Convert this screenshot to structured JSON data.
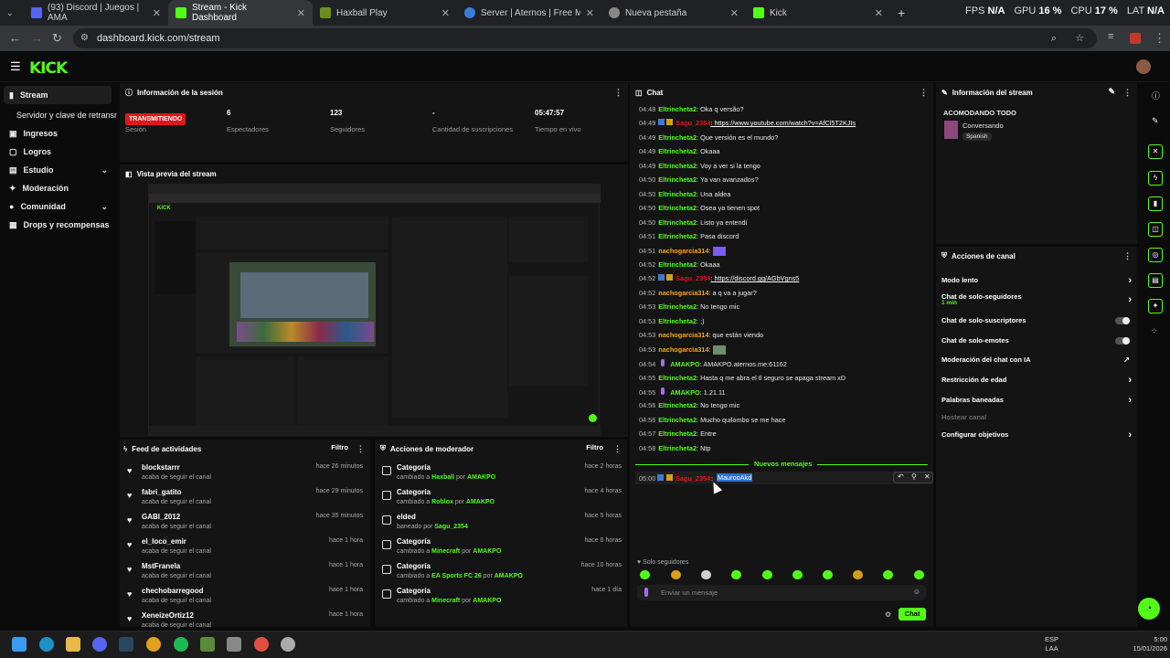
{
  "browser": {
    "tabs": [
      {
        "title": "(93) Discord | Juegos | AMA",
        "color": "#5865f2"
      },
      {
        "title": "Stream - Kick Dashboard",
        "color": "#53fc18"
      },
      {
        "title": "Haxball Play",
        "color": "#6b8e23"
      },
      {
        "title": "Server | Aternos | Free Minecraft",
        "color": "#3a7bd5"
      },
      {
        "title": "Nueva pestaña",
        "color": "#888888"
      },
      {
        "title": "Kick",
        "color": "#53fc18"
      }
    ],
    "new_tab": "+",
    "url": "dashboard.kick.com/stream",
    "stats": {
      "fps_label": "FPS",
      "fps": "N/A",
      "gpu_label": "GPU",
      "gpu": "16 %",
      "cpu_label": "CPU",
      "cpu": "17 %",
      "lat_label": "LAT",
      "lat": "N/A"
    }
  },
  "kick": {
    "logo": "KICK"
  },
  "sidebar": {
    "items": [
      {
        "label": "Stream"
      },
      {
        "label": "Servidor y clave de retransmisión"
      },
      {
        "label": "Ingresos"
      },
      {
        "label": "Logros"
      },
      {
        "label": "Estudio"
      },
      {
        "label": "Moderación"
      },
      {
        "label": "Comunidad"
      },
      {
        "label": "Drops y recompensas"
      }
    ]
  },
  "session": {
    "title": "Información de la sesión",
    "status": "TRANSMITIENDO",
    "status_label": "Sesión",
    "viewers": "6",
    "viewers_label": "Espectadores",
    "followers": "123",
    "followers_label": "Seguidores",
    "subs": "-",
    "subs_label": "Cantidad de suscripciones",
    "time": "05:47:57",
    "time_label": "Tiempo en vivo"
  },
  "preview": {
    "title": "Vista previa del stream"
  },
  "feed": {
    "title": "Feed de actividades",
    "filter": "Filtro",
    "items": [
      {
        "name": "blockstarrr",
        "sub": "acaba de seguir el canal",
        "time": "hace 26 minutos"
      },
      {
        "name": "fabri_gatito",
        "sub": "acaba de seguir el canal",
        "time": "hace 29 minutos"
      },
      {
        "name": "GABI_2012",
        "sub": "acaba de seguir el canal",
        "time": "hace 35 minutos"
      },
      {
        "name": "el_loco_emir",
        "sub": "acaba de seguir el canal",
        "time": "hace 1 hora"
      },
      {
        "name": "MstFranela",
        "sub": "acaba de seguir el canal",
        "time": "hace 1 hora"
      },
      {
        "name": "chechobarregood",
        "sub": "acaba de seguir el canal",
        "time": "hace 1 hora"
      },
      {
        "name": "XeneizeOrtiz12",
        "sub": "acaba de seguir el canal",
        "time": "hace 1 hora"
      }
    ]
  },
  "modactions": {
    "title": "Acciones de moderador",
    "filter": "Filtro",
    "items": [
      {
        "name": "Categoría",
        "pre": "cambiado a ",
        "target": "Haxball",
        "mid": " por ",
        "by": "AMAKPO",
        "time": "hace 2 horas"
      },
      {
        "name": "Categoría",
        "pre": "cambiado a ",
        "target": "Roblox",
        "mid": " por ",
        "by": "AMAKPO",
        "time": "hace 4 horas"
      },
      {
        "name": "elded",
        "pre": "baneado por ",
        "target": "Sagu_2354",
        "mid": "",
        "by": "",
        "time": "hace 5 horas"
      },
      {
        "name": "Categoría",
        "pre": "cambiado a ",
        "target": "Minecraft",
        "mid": " por ",
        "by": "AMAKPO",
        "time": "hace 6 horas"
      },
      {
        "name": "Categoría",
        "pre": "cambiado a ",
        "target": "EA Sports FC 26",
        "mid": " por ",
        "by": "AMAKPO",
        "time": "hace 10 horas"
      },
      {
        "name": "Categoría",
        "pre": "cambiado a ",
        "target": "Minecraft",
        "mid": " por ",
        "by": "AMAKPO",
        "time": "hace 1 día"
      }
    ]
  },
  "chat": {
    "title": "Chat",
    "messages": [
      {
        "t": "04:48",
        "u": "Eltrincheta2",
        "c": "#53fc18",
        "m": ": Oka q versão?"
      },
      {
        "t": "04:49",
        "u": "Sagu_2354",
        "c": "#e0161b",
        "m": ": https://www.youtube.com/watch?v=AfCl5T2KJIs",
        "link": true
      },
      {
        "t": "04:49",
        "u": "Eltrincheta2",
        "c": "#53fc18",
        "m": ": Que versión es el mundo?"
      },
      {
        "t": "04:49",
        "u": "Eltrincheta2",
        "c": "#53fc18",
        "m": ": Okaaa"
      },
      {
        "t": "04:49",
        "u": "Eltrincheta2",
        "c": "#53fc18",
        "m": ": Voy a ver si la tengo"
      },
      {
        "t": "04:50",
        "u": "Eltrincheta2",
        "c": "#53fc18",
        "m": ": Ya van avanzados?"
      },
      {
        "t": "04:50",
        "u": "Eltrincheta2",
        "c": "#53fc18",
        "m": ": Una aldea"
      },
      {
        "t": "04:50",
        "u": "Eltrincheta2",
        "c": "#53fc18",
        "m": ": Osea ya tienen spot"
      },
      {
        "t": "04:50",
        "u": "Eltrincheta2",
        "c": "#53fc18",
        "m": ": Listo ya entendí"
      },
      {
        "t": "04:51",
        "u": "Eltrincheta2",
        "c": "#53fc18",
        "m": ": Pasa discord"
      },
      {
        "t": "04:51",
        "u": "nachogarcia314",
        "c": "#f5a623",
        "m": ":"
      },
      {
        "t": "04:52",
        "u": "Eltrincheta2",
        "c": "#53fc18",
        "m": ": Okaaa"
      },
      {
        "t": "04:52",
        "u": "Sagu_2354",
        "c": "#e0161b",
        "m": ": https://discord.gg/AGbVgns5",
        "link": true
      },
      {
        "t": "04:52",
        "u": "nachogarcia314",
        "c": "#f5a623",
        "m": ": a q va a jugar?"
      },
      {
        "t": "04:53",
        "u": "Eltrincheta2",
        "c": "#53fc18",
        "m": ": No tengo mic"
      },
      {
        "t": "04:53",
        "u": "Eltrincheta2",
        "c": "#53fc18",
        "m": ": ;)"
      },
      {
        "t": "04:53",
        "u": "nachogarcia314",
        "c": "#f5a623",
        "m": ": que están viendo"
      },
      {
        "t": "04:53",
        "u": "nachogarcia314",
        "c": "#f5a623",
        "m": ":"
      },
      {
        "t": "04:54",
        "u": "AMAKPO",
        "c": "#53fc18",
        "m": ": AMAKPO.aternos.me:61162"
      },
      {
        "t": "04:55",
        "u": "Eltrincheta2",
        "c": "#53fc18",
        "m": ": Hasta q me abra el tl seguro se apaga stream xD"
      },
      {
        "t": "04:55",
        "u": "AMAKPO",
        "c": "#53fc18",
        "m": ": 1.21.11"
      },
      {
        "t": "04:56",
        "u": "Eltrincheta2",
        "c": "#53fc18",
        "m": ": No tengo mic"
      },
      {
        "t": "04:56",
        "u": "Eltrincheta2",
        "c": "#53fc18",
        "m": ": Mucho quilombo se me hace"
      },
      {
        "t": "04:57",
        "u": "Eltrincheta2",
        "c": "#53fc18",
        "m": ": Entre"
      },
      {
        "t": "04:58",
        "u": "Eltrincheta2",
        "c": "#53fc18",
        "m": ": Ntp"
      }
    ],
    "new_messages": "Nuevos mensajes",
    "last": {
      "t": "05:00",
      "u": "Sagu_2354",
      "m": "MaurooAkd"
    },
    "followers_only": "Solo seguidores",
    "input_placeholder": "Enviar un mensaje",
    "send": "Chat"
  },
  "streaminfo": {
    "title": "Información del stream",
    "stream_title": "ACOMODANDO TODO",
    "category": "Conversando",
    "language": "Spanish"
  },
  "channel_actions": {
    "title": "Acciones de canal",
    "items": [
      {
        "label": "Modo lento",
        "extra": ""
      },
      {
        "label": "Chat de solo-seguidores",
        "extra": "1 min"
      },
      {
        "label": "Chat de solo-suscriptores",
        "extra": ""
      },
      {
        "label": "Chat de solo-emotes",
        "extra": ""
      },
      {
        "label": "Moderación del chat con IA",
        "extra": ""
      },
      {
        "label": "Restricción de edad",
        "extra": ""
      },
      {
        "label": "Palabras baneadas",
        "extra": ""
      },
      {
        "label": "Hostear canal",
        "extra": ""
      },
      {
        "label": "Configurar objetivos",
        "extra": ""
      }
    ]
  },
  "taskbar": {
    "lang": "ESP",
    "lang2": "LAA",
    "time": "5:00",
    "date": "15/01/2026"
  }
}
